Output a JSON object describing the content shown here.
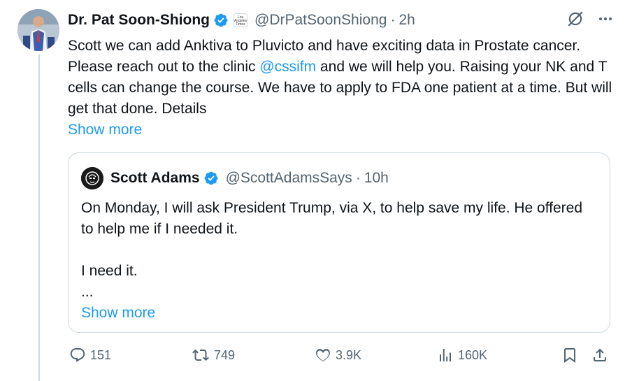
{
  "tweet": {
    "author_name": "Dr. Pat Soon-Shiong",
    "affiliation_badge": "Los Angeles Times",
    "handle": "@DrPatSoonShiong",
    "separator": "·",
    "time": "2h",
    "text_before_mention": "Scott we can add Anktiva to Pluvicto and have exciting data in Prostate cancer. Please reach out to the clinic ",
    "mention": "@cssifm",
    "text_after_mention": " and we will help you. Raising your NK and T cells can change the course. We have to apply to FDA one patient at a time. But will get that done. Details",
    "show_more": "Show more"
  },
  "quote": {
    "author_name": "Scott Adams",
    "handle": "@ScottAdamsSays",
    "separator": "·",
    "time": "10h",
    "line1": "On Monday, I will ask President Trump, via X, to help save my life. He offered to help me if I needed it.",
    "line2": "I need it.",
    "line3": "...",
    "show_more": "Show more"
  },
  "actions": {
    "replies": "151",
    "reposts": "749",
    "likes": "3.9K",
    "views": "160K"
  },
  "icons": [
    "verified-badge-icon",
    "grok-icon",
    "more-icon",
    "reply-icon",
    "repost-icon",
    "like-icon",
    "views-icon",
    "bookmark-icon",
    "share-icon"
  ],
  "colors": {
    "accent": "#1d9bf0",
    "muted": "#536471",
    "border": "#cfd9de"
  }
}
